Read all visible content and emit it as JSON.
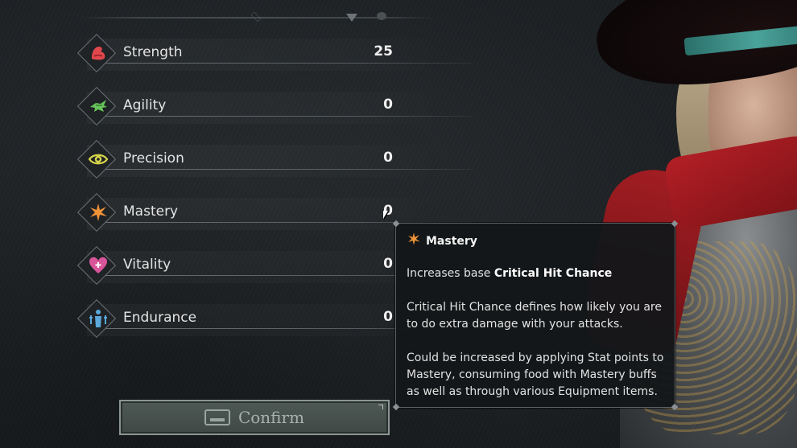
{
  "stats": [
    {
      "name": "Strength",
      "value": "25",
      "icon": "flexed-arm-icon",
      "color": "#e0474c"
    },
    {
      "name": "Agility",
      "value": "0",
      "icon": "feathered-foot-icon",
      "color": "#67c45a"
    },
    {
      "name": "Precision",
      "value": "0",
      "icon": "eye-icon",
      "color": "#d8d64a"
    },
    {
      "name": "Mastery",
      "value": "0",
      "icon": "starburst-icon",
      "color": "#ef9238"
    },
    {
      "name": "Vitality",
      "value": "0",
      "icon": "heart-icon",
      "color": "#d9559a"
    },
    {
      "name": "Endurance",
      "value": "0",
      "icon": "figure-icon",
      "color": "#5aa8dc"
    }
  ],
  "tooltip": {
    "title": "Mastery",
    "intro_prefix": "Increases base ",
    "intro_bold": "Critical Hit Chance",
    "paragraph2": "Critical Hit Chance defines how likely you are to do extra damage with your attacks.",
    "paragraph3": "Could be increased by applying Stat points to Mastery, consuming food with Mastery buffs as well as through various Equipment items."
  },
  "confirm": {
    "label": "Confirm",
    "state": "disabled"
  }
}
